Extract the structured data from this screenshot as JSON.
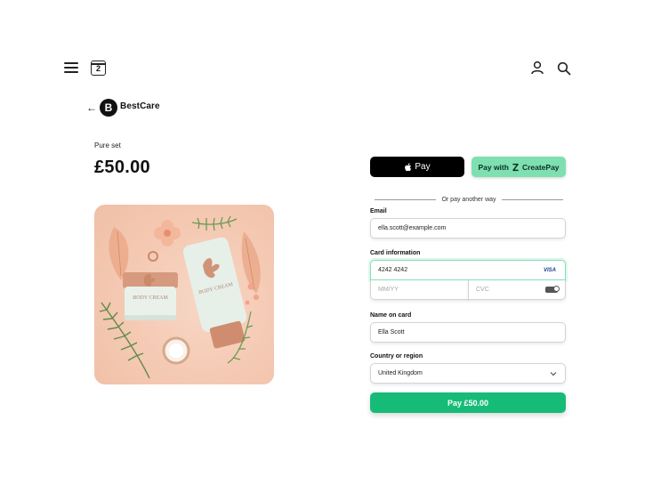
{
  "topbar": {
    "calendar_day": "2"
  },
  "brand": {
    "back_arrow": "←",
    "logo_letter": "B",
    "name": "BestCare"
  },
  "product": {
    "name": "Pure set",
    "price": "£50.00",
    "jar_label": "BODY CREAM",
    "tube_label": "BODY CREAM"
  },
  "payment": {
    "apple_pay_label": "Pay",
    "create_pay_label": "Pay with",
    "create_pay_brand": "CreatePay",
    "divider_text": "Or pay another way",
    "email": {
      "label": "Email",
      "value": "ella.scott@example.com"
    },
    "card": {
      "label": "Card information",
      "number": "4242 4242",
      "brand": "VISA",
      "expiry_placeholder": "MM/YY",
      "cvc_placeholder": "CVC"
    },
    "name": {
      "label": "Name on card",
      "value": "Ella Scott"
    },
    "country": {
      "label": "Country or region",
      "value": "United Kingdom"
    },
    "pay_button_label": "Pay £50.00"
  },
  "colors": {
    "create_pay_bg": "#7ee0b0",
    "pay_button_bg": "#17bb78",
    "focus_border": "#83e0b6",
    "image_bg": "#f5cbb5"
  }
}
